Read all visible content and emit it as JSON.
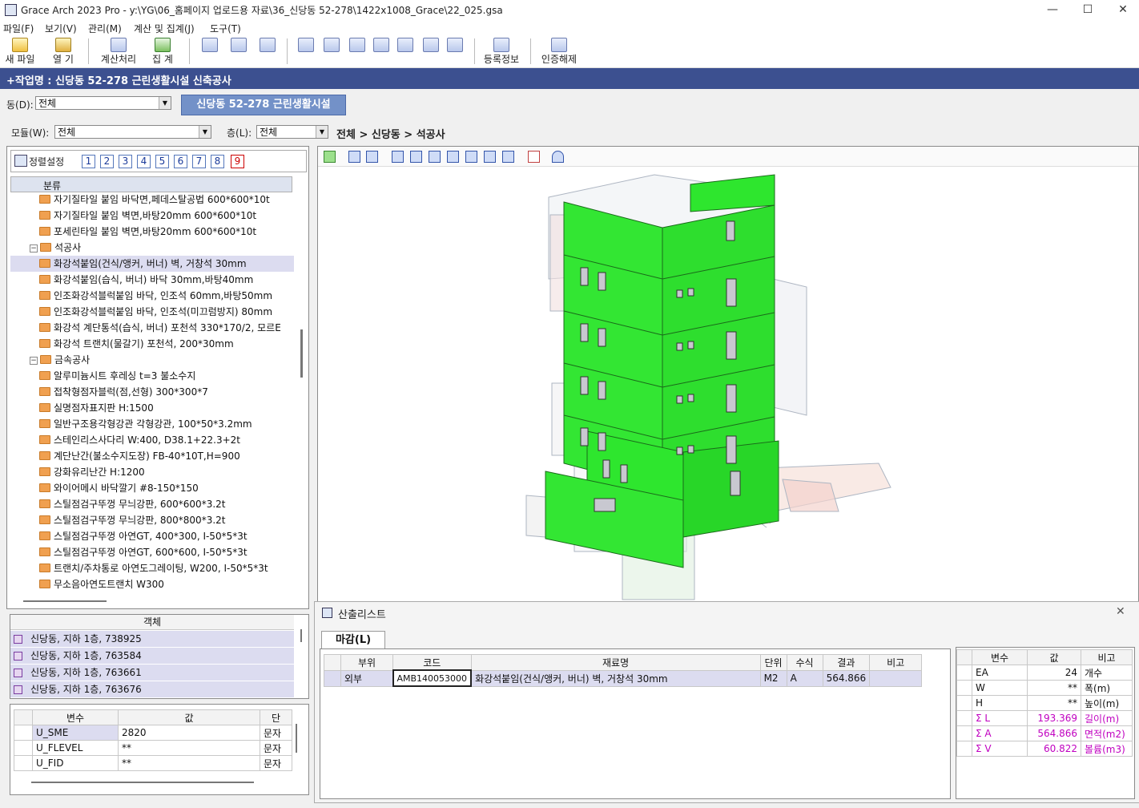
{
  "window": {
    "title": "Grace Arch 2023 Pro - y:\\YG\\06_홈페이지 업로드용 자료\\36_신당동 52-278\\1422x1008_Grace\\22_025.gsa",
    "min": "—",
    "max": "☐",
    "close": "✕"
  },
  "menu": [
    "파일(F)",
    "보기(V)",
    "관리(M)",
    "계산 및 집계(J)",
    "도구(T)"
  ],
  "toolbar": {
    "new_file": "새 파일",
    "open": "열  기",
    "calculate": "계산처리",
    "aggregate": "집  계",
    "register": "등록정보",
    "release_auth": "인증해제"
  },
  "project": {
    "label": "+작업명 : 신당동 52-278 근린생활시설 신축공사"
  },
  "building": {
    "label": "동(D):",
    "value": "전체",
    "tab": "신당동 52-278 근린생활시설"
  },
  "filter": {
    "module_label": "모듈(W):",
    "module_value": "전체",
    "floor_label": "층(L):",
    "floor_value": "전체",
    "breadcrumb": "전체 > 신당동 > 석공사"
  },
  "sort": {
    "label": "정렬설정",
    "numbers": [
      "1",
      "2",
      "3",
      "4",
      "5",
      "6",
      "7",
      "8",
      "9"
    ],
    "active": "9"
  },
  "tree": {
    "header": "분류",
    "rows": [
      {
        "type": "item",
        "text": "자기질타일 붙임  바닥면,페데스탈공법  600*600*10t"
      },
      {
        "type": "item",
        "text": "자기질타일 붙임  벽면,바탕20mm 600*600*10t"
      },
      {
        "type": "item",
        "text": "포세린타일 붙임  벽면,바탕20mm 600*600*10t"
      },
      {
        "type": "group",
        "text": "석공사"
      },
      {
        "type": "item",
        "text": "화강석붙임(건식/앵커, 버너)  벽, 거창석 30mm",
        "selected": true
      },
      {
        "type": "item",
        "text": "화강석붙임(습식, 버너)  바닥 30mm,바탕40mm"
      },
      {
        "type": "item",
        "text": "인조화강석블럭붙임  바닥, 인조석 60mm,바탕50mm"
      },
      {
        "type": "item",
        "text": "인조화강석블럭붙임  바닥, 인조석(미끄럼방지) 80mm"
      },
      {
        "type": "item",
        "text": "화강석 계단통석(습식, 버너)  포천석 330*170/2, 모르E"
      },
      {
        "type": "item",
        "text": "화강석 트랜치(물갈기)  포천석, 200*30mm"
      },
      {
        "type": "group",
        "text": "금속공사"
      },
      {
        "type": "item",
        "text": "알루미늄시트 후레싱  t=3 불소수지"
      },
      {
        "type": "item",
        "text": "접착형점자블럭(점,선형)  300*300*7"
      },
      {
        "type": "item",
        "text": "실명점자표지판  H:1500"
      },
      {
        "type": "item",
        "text": "일반구조용각형강관  각형강관, 100*50*3.2mm"
      },
      {
        "type": "item",
        "text": "스테인리스사다리  W:400, D38.1+22.3+2t"
      },
      {
        "type": "item",
        "text": "계단난간(불소수지도장)  FB-40*10T,H=900"
      },
      {
        "type": "item",
        "text": "강화유리난간  H:1200"
      },
      {
        "type": "item",
        "text": "와이어메시 바닥깔기  #8-150*150"
      },
      {
        "type": "item",
        "text": "스틸점검구뚜껑  무늬강판, 600*600*3.2t"
      },
      {
        "type": "item",
        "text": "스틸점검구뚜껑  무늬강판, 800*800*3.2t"
      },
      {
        "type": "item",
        "text": "스틸점검구뚜껑  아연GT, 400*300, I-50*5*3t"
      },
      {
        "type": "item",
        "text": "스틸점검구뚜껑  아연GT, 600*600, I-50*5*3t"
      },
      {
        "type": "item",
        "text": "트랜치/주차통로  아연도그레이팅, W200, I-50*5*3t"
      },
      {
        "type": "item",
        "text": "무소음아연도트랜치  W300"
      }
    ]
  },
  "objects": {
    "header": "객체",
    "rows": [
      "신당동, 지하 1층, 738925",
      "신당동, 지하 1층, 763584",
      "신당동, 지하 1층, 763661",
      "신당동, 지하 1층, 763676"
    ]
  },
  "variables": {
    "headers": [
      "변수",
      "값",
      "단"
    ],
    "rows": [
      {
        "name": "U_SME",
        "value": "2820",
        "unit": "문자"
      },
      {
        "name": "U_FLEVEL",
        "value": "**",
        "unit": "문자"
      },
      {
        "name": "U_FID",
        "value": "**",
        "unit": "문자"
      }
    ]
  },
  "result_window": {
    "title": "산출리스트",
    "close": "✕",
    "tab": "마감(L)",
    "headers": [
      "부위",
      "코드",
      "재료명",
      "단위",
      "수식",
      "결과",
      "비고"
    ],
    "rows": [
      {
        "part": "외부",
        "code": "AMB140053000",
        "material": "화강석붙임(건식/앵커, 버너)  벽, 거창석 30mm",
        "unit": "M2",
        "formula": "A",
        "result": "564.866",
        "note": ""
      }
    ]
  },
  "summary": {
    "headers": [
      "변수",
      "값",
      "비고"
    ],
    "rows": [
      {
        "sigma": false,
        "name": "EA",
        "value": "24",
        "note": "개수"
      },
      {
        "sigma": false,
        "name": "W",
        "value": "**",
        "note": "폭(m)"
      },
      {
        "sigma": false,
        "name": "H",
        "value": "**",
        "note": "높이(m)"
      },
      {
        "sigma": true,
        "name": "L",
        "value": "193.369",
        "note": "길이(m)"
      },
      {
        "sigma": true,
        "name": "A",
        "value": "564.866",
        "note": "면적(m2)"
      },
      {
        "sigma": true,
        "name": "V",
        "value": "60.822",
        "note": "볼륨(m3)"
      }
    ]
  },
  "colors": {
    "accent": "#3c5090",
    "tab": "#7391c8",
    "model_green": "#2ee62e",
    "selection": "#dcdcf0",
    "sigma": "#c000c0"
  }
}
